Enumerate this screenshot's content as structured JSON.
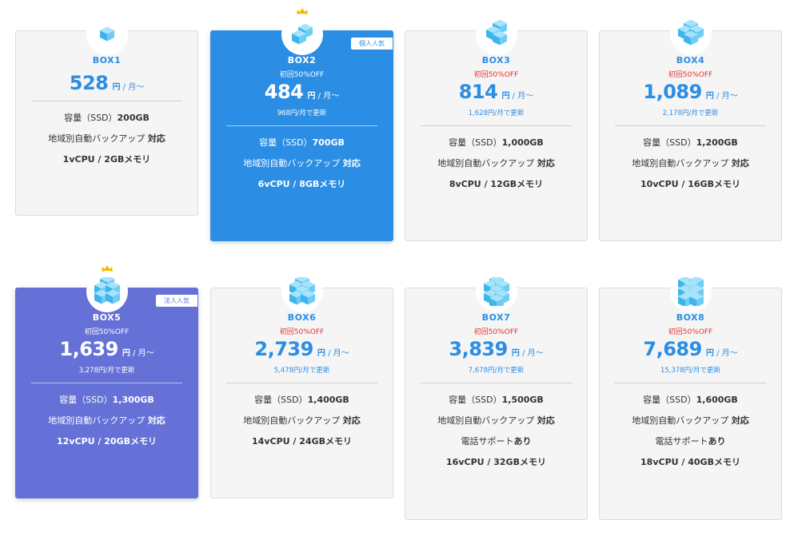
{
  "colors": {
    "accent_blue": "#2b8ee4",
    "accent_purple": "#6571d6",
    "discount_red": "#e5322d",
    "cube_light": "#6ccdf5",
    "crown_gold": "#f5b800"
  },
  "plans": [
    {
      "id": "box1",
      "name": "BOX1",
      "discount": "",
      "price": "528",
      "yen": "円",
      "per": " / 月〜",
      "renew": "",
      "tag": "",
      "crown": false,
      "cubes": 1,
      "specs": [
        {
          "label": "容量（SSD）",
          "value": "200GB"
        },
        {
          "label": "地域別自動バックアップ ",
          "value": "対応"
        },
        {
          "label": "",
          "value": "1vCPU / 2GBメモリ"
        }
      ]
    },
    {
      "id": "box2",
      "name": "BOX2",
      "discount": "初回50%OFF",
      "price": "484",
      "yen": "円",
      "per": " / 月〜",
      "renew": "968円/月で更新",
      "tag": "個人人気",
      "crown": true,
      "cubes": 2,
      "specs": [
        {
          "label": "容量（SSD）",
          "value": "700GB"
        },
        {
          "label": "地域別自動バックアップ ",
          "value": "対応"
        },
        {
          "label": "",
          "value": "6vCPU / 8GBメモリ"
        }
      ]
    },
    {
      "id": "box3",
      "name": "BOX3",
      "discount": "初回50%OFF",
      "price": "814",
      "yen": "円",
      "per": " / 月〜",
      "renew": "1,628円/月で更新",
      "tag": "",
      "crown": false,
      "cubes": 3,
      "specs": [
        {
          "label": "容量（SSD）",
          "value": "1,000GB"
        },
        {
          "label": "地域別自動バックアップ ",
          "value": "対応"
        },
        {
          "label": "",
          "value": "8vCPU / 12GBメモリ"
        }
      ]
    },
    {
      "id": "box4",
      "name": "BOX4",
      "discount": "初回50%OFF",
      "price": "1,089",
      "yen": "円",
      "per": " / 月〜",
      "renew": "2,178円/月で更新",
      "tag": "",
      "crown": false,
      "cubes": 4,
      "specs": [
        {
          "label": "容量（SSD）",
          "value": "1,200GB"
        },
        {
          "label": "地域別自動バックアップ ",
          "value": "対応"
        },
        {
          "label": "",
          "value": "10vCPU / 16GBメモリ"
        }
      ]
    },
    {
      "id": "box5",
      "name": "BOX5",
      "discount": "初回50%OFF",
      "price": "1,639",
      "yen": "円",
      "per": " / 月〜",
      "renew": "3,278円/月で更新",
      "tag": "法人人気",
      "crown": true,
      "cubes": 5,
      "specs": [
        {
          "label": "容量（SSD）",
          "value": "1,300GB"
        },
        {
          "label": "地域別自動バックアップ ",
          "value": "対応"
        },
        {
          "label": "",
          "value": "12vCPU / 20GBメモリ"
        }
      ]
    },
    {
      "id": "box6",
      "name": "BOX6",
      "discount": "初回50%OFF",
      "price": "2,739",
      "yen": "円",
      "per": " / 月〜",
      "renew": "5,478円/月で更新",
      "tag": "",
      "crown": false,
      "cubes": 6,
      "specs": [
        {
          "label": "容量（SSD）",
          "value": "1,400GB"
        },
        {
          "label": "地域別自動バックアップ ",
          "value": "対応"
        },
        {
          "label": "",
          "value": "14vCPU / 24GBメモリ"
        }
      ]
    },
    {
      "id": "box7",
      "name": "BOX7",
      "discount": "初回50%OFF",
      "price": "3,839",
      "yen": "円",
      "per": " / 月〜",
      "renew": "7,678円/月で更新",
      "tag": "",
      "crown": false,
      "cubes": 7,
      "specs": [
        {
          "label": "容量（SSD）",
          "value": "1,500GB"
        },
        {
          "label": "地域別自動バックアップ ",
          "value": "対応"
        },
        {
          "label": "電話サポート",
          "value": "あり"
        },
        {
          "label": "",
          "value": "16vCPU / 32GBメモリ"
        }
      ]
    },
    {
      "id": "box8",
      "name": "BOX8",
      "discount": "初回50%OFF",
      "price": "7,689",
      "yen": "円",
      "per": " / 月〜",
      "renew": "15,378円/月で更新",
      "tag": "",
      "crown": false,
      "cubes": 8,
      "specs": [
        {
          "label": "容量（SSD）",
          "value": "1,600GB"
        },
        {
          "label": "地域別自動バックアップ ",
          "value": "対応"
        },
        {
          "label": "電話サポート",
          "value": "あり"
        },
        {
          "label": "",
          "value": "18vCPU / 40GBメモリ"
        }
      ]
    }
  ]
}
